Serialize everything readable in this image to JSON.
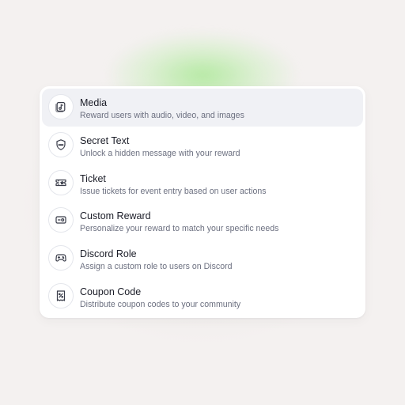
{
  "menu": {
    "items": [
      {
        "icon": "music-file-icon",
        "title": "Media",
        "description": "Reward users with audio, video, and images",
        "active": true
      },
      {
        "icon": "shield-password-icon",
        "title": "Secret Text",
        "description": "Unlock a hidden message with your reward",
        "active": false
      },
      {
        "icon": "ticket-star-icon",
        "title": "Ticket",
        "description": "Issue tickets for event entry based on user actions",
        "active": false
      },
      {
        "icon": "card-toggle-icon",
        "title": "Custom Reward",
        "description": "Personalize your reward to match your specific needs",
        "active": false
      },
      {
        "icon": "gamepad-icon",
        "title": "Discord Role",
        "description": "Assign a custom role to users on Discord",
        "active": false
      },
      {
        "icon": "coupon-percent-icon",
        "title": "Coupon Code",
        "description": "Distribute coupon codes to your community",
        "active": false
      }
    ]
  },
  "colors": {
    "background": "#f4f1f0",
    "glow": "#aee896",
    "panel": "#ffffff",
    "active_row": "#f0f1f5",
    "title_text": "#1b1d28",
    "description_text": "#6c7080",
    "icon_stroke": "#3a3d4a"
  }
}
